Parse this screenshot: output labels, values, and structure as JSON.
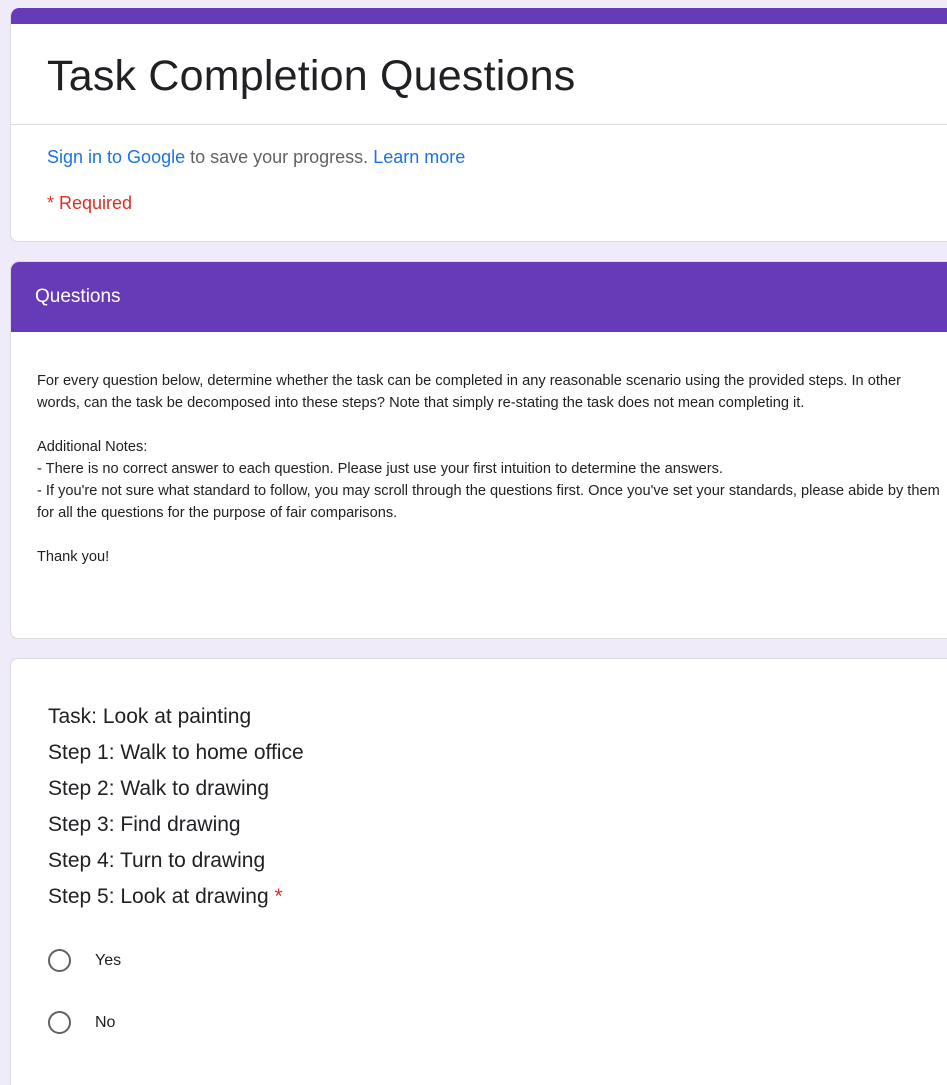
{
  "form": {
    "title": "Task Completion Questions",
    "signin_link": "Sign in to Google",
    "signin_rest": " to save your progress. ",
    "learn_more": "Learn more",
    "required_note": "* Required"
  },
  "section": {
    "title": "Questions",
    "paragraph1": "For every question below, determine whether the task can be completed in any reasonable scenario using the provided steps. In other words, can the task be decomposed into these steps? Note that simply re-stating the task does not mean completing it.",
    "notes_heading": "Additional Notes:",
    "note1": "- There is no correct answer to each question. Please just use your first intuition to determine the answers.",
    "note2": "- If you're not sure what standard to follow, you may scroll through the questions first. Once you've set your standards, please abide by them for all the questions for the purpose of fair comparisons.",
    "thanks": "Thank you!"
  },
  "question": {
    "lines": [
      "Task: Look at painting",
      "Step 1: Walk to home office",
      "Step 2: Walk to drawing",
      "Step 3: Find drawing",
      "Step 4: Turn to drawing",
      "Step 5: Look at drawing"
    ],
    "required_marker": "*",
    "options": [
      "Yes",
      "No"
    ]
  },
  "colors": {
    "accent": "#673ab7",
    "background": "#f0ebf8",
    "link": "#1a73e8",
    "required": "#d93025"
  }
}
